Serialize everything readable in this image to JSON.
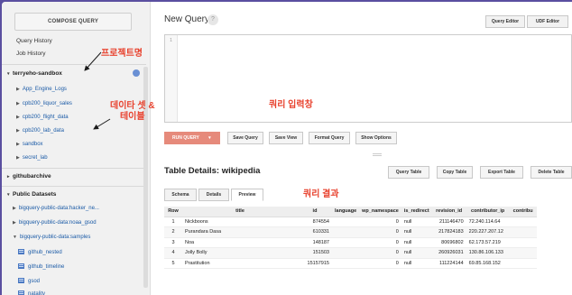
{
  "sidebar": {
    "compose_label": "COMPOSE QUERY",
    "links": [
      "Query History",
      "Job History"
    ],
    "project": "terryeho-sandbox",
    "datasets": [
      "App_Engine_Logs",
      "cpb200_liquor_sales",
      "cpb200_flight_data",
      "cpb200_lab_data",
      "sandbox",
      "secret_lab"
    ],
    "githubarchive": "githubarchive",
    "public_datasets": "Public Datasets",
    "public_items": [
      "bigquery-public-data:hacker_ne...",
      "bigquery-public-data:noaa_gsod",
      "bigquery-public-data:samples"
    ],
    "tables": [
      "github_nested",
      "github_timeline",
      "gsod",
      "natality"
    ]
  },
  "query": {
    "title": "New Query",
    "help": "?",
    "query_editor": "Query Editor",
    "udf_editor": "UDF Editor",
    "line_number": "1",
    "run": "RUN QUERY",
    "run_caret": "▾",
    "save_query": "Save Query",
    "save_view": "Save View",
    "format_query": "Format Query",
    "show_options": "Show Options"
  },
  "details": {
    "title": "Table Details: wikipedia",
    "buttons": [
      "Query Table",
      "Copy Table",
      "Export Table",
      "Delete Table"
    ],
    "tabs": [
      "Schema",
      "Details",
      "Preview"
    ],
    "columns": [
      "Row",
      "title",
      "id",
      "language",
      "wp_namespace",
      "is_redirect",
      "revision_id",
      "contributor_ip",
      "contribu"
    ],
    "rows": [
      [
        "1",
        "Nickboons",
        "874554",
        "",
        "0",
        "null",
        "211146470",
        "72.240.114.64",
        ""
      ],
      [
        "2",
        "Purandara Dasa",
        "610331",
        "",
        "0",
        "null",
        "217824183",
        "220.227.207.12",
        ""
      ],
      [
        "3",
        "Noa",
        "148187",
        "",
        "0",
        "null",
        "80696802",
        "62.173.57.219",
        ""
      ],
      [
        "4",
        "Jolly Bolly",
        "151503",
        "",
        "0",
        "null",
        "260926031",
        "130.86.106.133",
        ""
      ],
      [
        "5",
        "Prastitution",
        "15157915",
        "",
        "0",
        "null",
        "111224144",
        "69.85.168.152",
        ""
      ]
    ]
  },
  "annotations": {
    "project": "프로젝트명",
    "editor": "쿼리 입력창",
    "dataset_line1": "데이타 셋 &",
    "dataset_line2": "테이블",
    "result": "쿼리 결과"
  },
  "colors": {
    "accent_red": "#e8432f",
    "link_blue": "#1a5aa6",
    "run_button": "#e68a7b",
    "frame_purple": "#5a4fa0"
  }
}
